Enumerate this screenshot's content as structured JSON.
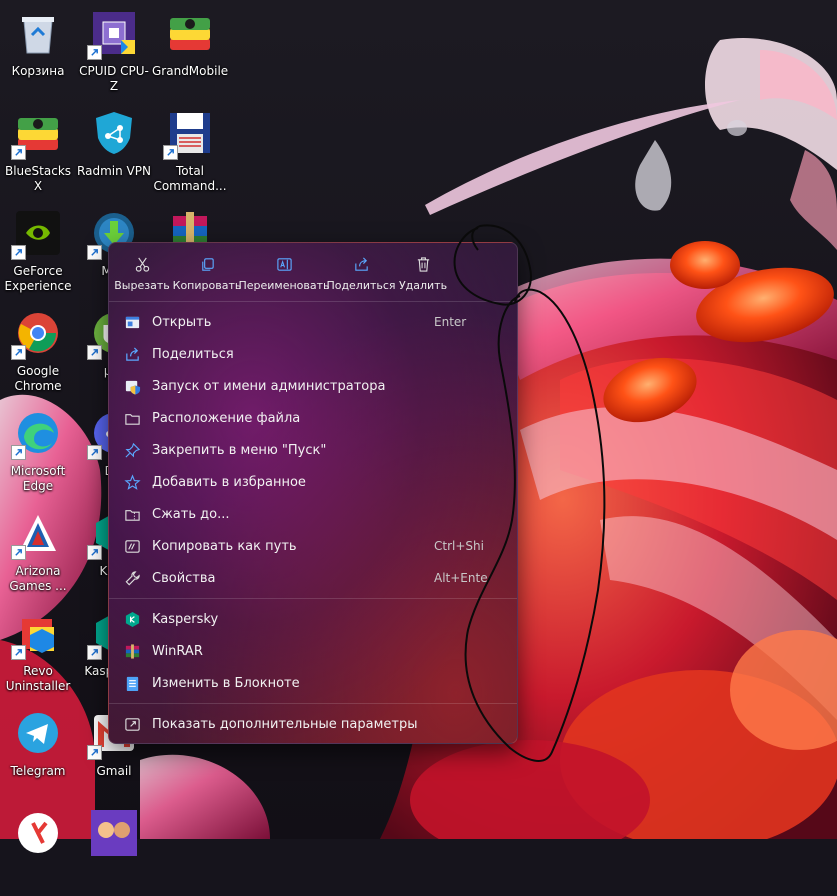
{
  "desktop": {
    "icons": [
      {
        "label": "Корзина"
      },
      {
        "label": "CPUID CPU-Z"
      },
      {
        "label": "GrandMobile"
      },
      {
        "label": "BlueStacks X"
      },
      {
        "label": "Radmin VPN"
      },
      {
        "label": "Total Command..."
      },
      {
        "label": "GeForce Experience"
      },
      {
        "label": "Med"
      },
      {
        "label": ""
      },
      {
        "label": "Google Chrome"
      },
      {
        "label": "µTo"
      },
      {
        "label": "Microsoft Edge"
      },
      {
        "label": "Dis"
      },
      {
        "label": "Arizona Games ..."
      },
      {
        "label": "Kasp"
      },
      {
        "label": "Revo Uninstaller"
      },
      {
        "label": "Kasp Pass"
      },
      {
        "label": "Telegram"
      },
      {
        "label": "Gmail"
      }
    ]
  },
  "context_menu": {
    "top_actions": [
      {
        "label": "Вырезать",
        "icon": "scissors-icon"
      },
      {
        "label": "Копировать",
        "icon": "copy-icon"
      },
      {
        "label": "Переименовать",
        "icon": "rename-icon"
      },
      {
        "label": "Поделиться",
        "icon": "share-icon"
      },
      {
        "label": "Удалить",
        "icon": "trash-icon"
      }
    ],
    "items": [
      {
        "label": "Открыть",
        "shortcut": "Enter",
        "icon": "open-app-icon"
      },
      {
        "label": "Поделиться",
        "shortcut": "",
        "icon": "share-icon"
      },
      {
        "label": "Запуск от имени администратора",
        "shortcut": "",
        "icon": "admin-shield-icon"
      },
      {
        "label": "Расположение файла",
        "shortcut": "",
        "icon": "folder-icon"
      },
      {
        "label": "Закрепить в меню \"Пуск\"",
        "shortcut": "",
        "icon": "pin-icon"
      },
      {
        "label": "Добавить в избранное",
        "shortcut": "",
        "icon": "star-icon"
      },
      {
        "label": "Сжать до...",
        "shortcut": "",
        "icon": "zip-icon"
      },
      {
        "label": "Копировать как путь",
        "shortcut": "Ctrl+Shi",
        "icon": "copy-path-icon"
      },
      {
        "label": "Свойства",
        "shortcut": "Alt+Ente",
        "icon": "wrench-icon"
      }
    ],
    "app_items": [
      {
        "label": "Kaspersky",
        "icon": "kaspersky-icon"
      },
      {
        "label": "WinRAR",
        "icon": "winrar-icon"
      },
      {
        "label": "Изменить в Блокноте",
        "icon": "notepad-icon"
      }
    ],
    "more_options": {
      "label": "Показать дополнительные параметры",
      "icon": "more-options-icon"
    }
  },
  "colors": {
    "accent_orange": "#ff5a1a",
    "menu_text": "#f2f2f2",
    "kaspersky_green": "#00a88e"
  }
}
